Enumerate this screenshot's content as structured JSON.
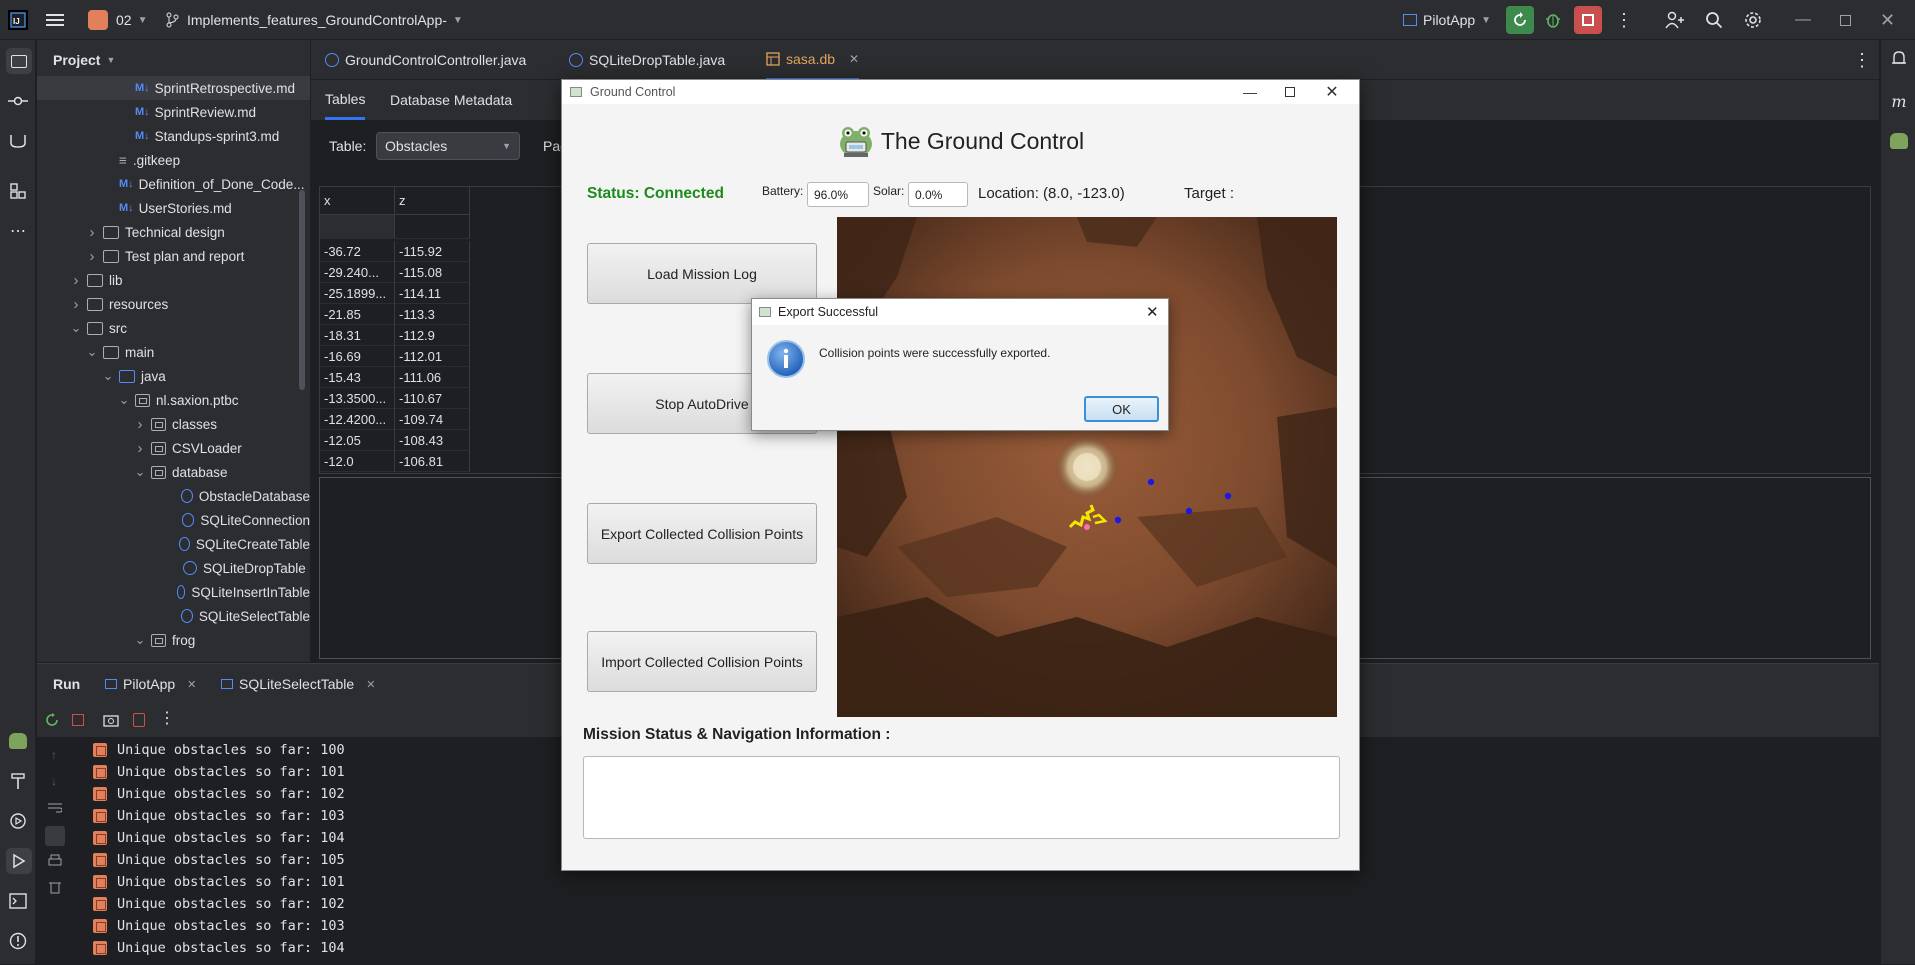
{
  "ide": {
    "project_badge": "02",
    "branch": "Implements_features_GroundControlApp-",
    "run_config": "PilotApp"
  },
  "project_panel": {
    "title": "Project",
    "tree": [
      {
        "label": "SprintRetrospective.md",
        "type": "md",
        "selected": true
      },
      {
        "label": "SprintReview.md",
        "type": "md"
      },
      {
        "label": "Standups-sprint3.md",
        "type": "md"
      },
      {
        "label": ".gitkeep",
        "type": "file"
      },
      {
        "label": "Definition_of_Done_Code...",
        "type": "md"
      },
      {
        "label": "UserStories.md",
        "type": "md"
      },
      {
        "label": "Technical design",
        "type": "folder"
      },
      {
        "label": "Test plan and report",
        "type": "folder"
      },
      {
        "label": "lib",
        "type": "folder"
      },
      {
        "label": "resources",
        "type": "folder"
      },
      {
        "label": "src",
        "type": "folder"
      },
      {
        "label": "main",
        "type": "folder"
      },
      {
        "label": "java",
        "type": "folder-blue"
      },
      {
        "label": "nl.saxion.ptbc",
        "type": "package"
      },
      {
        "label": "classes",
        "type": "package"
      },
      {
        "label": "CSVLoader",
        "type": "package"
      },
      {
        "label": "database",
        "type": "package"
      },
      {
        "label": "ObstacleDatabase",
        "type": "class"
      },
      {
        "label": "SQLiteConnection",
        "type": "class"
      },
      {
        "label": "SQLiteCreateTable",
        "type": "class"
      },
      {
        "label": "SQLiteDropTable",
        "type": "class"
      },
      {
        "label": "SQLiteInsertInTable",
        "type": "class"
      },
      {
        "label": "SQLiteSelectTable",
        "type": "class"
      },
      {
        "label": "frog",
        "type": "package"
      }
    ]
  },
  "editor": {
    "tabs": [
      "GroundControlController.java",
      "SQLiteDropTable.java",
      "sasa.db"
    ],
    "db_tabs": [
      "Tables",
      "Database Metadata"
    ],
    "table_label": "Table:",
    "table_value": "Obstacles",
    "page_label": "Pag",
    "columns": [
      "x",
      "z"
    ],
    "rows": [
      [
        "-36.72",
        "-115.92"
      ],
      [
        "-29.240...",
        "-115.08"
      ],
      [
        "-25.1899...",
        "-114.11"
      ],
      [
        "-21.85",
        "-113.3"
      ],
      [
        "-18.31",
        "-112.9"
      ],
      [
        "-16.69",
        "-112.01"
      ],
      [
        "-15.43",
        "-111.06"
      ],
      [
        "-13.3500...",
        "-110.67"
      ],
      [
        "-12.4200...",
        "-109.74"
      ],
      [
        "-12.05",
        "-108.43"
      ],
      [
        "-12.0",
        "-106.81"
      ]
    ]
  },
  "run_panel": {
    "title": "Run",
    "tabs": [
      "PilotApp",
      "SQLiteSelectTable"
    ],
    "lines": [
      "Unique obstacles so far: 100",
      "Unique obstacles so far: 101",
      "Unique obstacles so far: 102",
      "Unique obstacles so far: 103",
      "Unique obstacles so far: 104",
      "Unique obstacles so far: 105",
      "Unique obstacles so far: 101",
      "Unique obstacles so far: 102",
      "Unique obstacles so far: 103",
      "Unique obstacles so far: 104"
    ]
  },
  "ground_control": {
    "window_title": "Ground Control",
    "heading": "The Ground Control",
    "status": "Status: Connected",
    "battery_label": "Battery:",
    "battery_value": "96.0%",
    "solar_label": "Solar:",
    "solar_value": "0.0%",
    "location": "Location: (8.0, -123.0)",
    "target": "Target :",
    "buttons": [
      "Load Mission Log",
      "Stop AutoDrive",
      "Export Collected Collision Points",
      "Import Collected Collision Points"
    ],
    "mission_label": "Mission Status & Navigation Information :"
  },
  "dialog": {
    "title": "Export Successful",
    "message": "Collision points were successfully exported.",
    "ok": "OK"
  },
  "colors": {
    "accent": "#3574f0",
    "status_green": "#1d8a1d",
    "ide_bg": "#1e1f22",
    "panel_bg": "#2b2d30"
  }
}
